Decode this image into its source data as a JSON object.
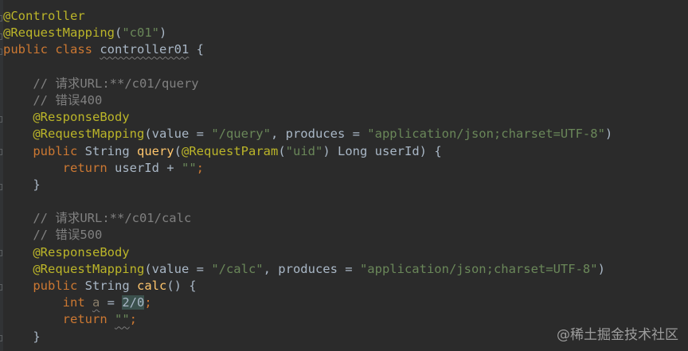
{
  "code_lines": [
    [
      {
        "t": "@Controller",
        "c": "ann"
      }
    ],
    [
      {
        "t": "@RequestMapping",
        "c": "ann"
      },
      {
        "t": "(",
        "c": "plain"
      },
      {
        "t": "\"c01\"",
        "c": "str"
      },
      {
        "t": ")",
        "c": "plain"
      }
    ],
    [
      {
        "t": "public class ",
        "c": "kw"
      },
      {
        "t": "controller01",
        "c": "plain",
        "u": true
      },
      {
        "t": " {",
        "c": "plain"
      }
    ],
    [],
    [
      {
        "t": "    // 请求URL:**/c01/query",
        "c": "cmt"
      }
    ],
    [
      {
        "t": "    // 错误400",
        "c": "cmt"
      }
    ],
    [
      {
        "t": "    ",
        "c": "plain"
      },
      {
        "t": "@ResponseBody",
        "c": "ann"
      }
    ],
    [
      {
        "t": "    ",
        "c": "plain"
      },
      {
        "t": "@RequestMapping",
        "c": "ann"
      },
      {
        "t": "(value = ",
        "c": "plain"
      },
      {
        "t": "\"/query\"",
        "c": "str"
      },
      {
        "t": ", produces = ",
        "c": "plain"
      },
      {
        "t": "\"application/json;charset=UTF-8\"",
        "c": "str"
      },
      {
        "t": ")",
        "c": "plain"
      }
    ],
    [
      {
        "t": "    ",
        "c": "plain"
      },
      {
        "t": "public ",
        "c": "kw"
      },
      {
        "t": "String ",
        "c": "plain"
      },
      {
        "t": "query",
        "c": "fn"
      },
      {
        "t": "(",
        "c": "plain"
      },
      {
        "t": "@RequestParam",
        "c": "ann"
      },
      {
        "t": "(",
        "c": "plain"
      },
      {
        "t": "\"uid\"",
        "c": "str"
      },
      {
        "t": ") Long userId) {",
        "c": "plain"
      }
    ],
    [
      {
        "t": "        ",
        "c": "plain"
      },
      {
        "t": "return ",
        "c": "kw"
      },
      {
        "t": "userId + ",
        "c": "plain"
      },
      {
        "t": "\"\"",
        "c": "str"
      },
      {
        "t": ";",
        "c": "kw"
      }
    ],
    [
      {
        "t": "    }",
        "c": "plain"
      }
    ],
    [],
    [
      {
        "t": "    // 请求URL:**/c01/calc",
        "c": "cmt"
      }
    ],
    [
      {
        "t": "    // 错误500",
        "c": "cmt"
      }
    ],
    [
      {
        "t": "    ",
        "c": "plain"
      },
      {
        "t": "@ResponseBody",
        "c": "ann"
      }
    ],
    [
      {
        "t": "    ",
        "c": "plain"
      },
      {
        "t": "@RequestMapping",
        "c": "ann"
      },
      {
        "t": "(value = ",
        "c": "plain"
      },
      {
        "t": "\"/calc\"",
        "c": "str"
      },
      {
        "t": ", produces = ",
        "c": "plain"
      },
      {
        "t": "\"application/json;charset=UTF-8\"",
        "c": "str"
      },
      {
        "t": ")",
        "c": "plain"
      }
    ],
    [
      {
        "t": "    ",
        "c": "plain"
      },
      {
        "t": "public ",
        "c": "kw"
      },
      {
        "t": "String ",
        "c": "plain"
      },
      {
        "t": "calc",
        "c": "fn"
      },
      {
        "t": "() {",
        "c": "plain"
      }
    ],
    [
      {
        "t": "        ",
        "c": "plain"
      },
      {
        "t": "int ",
        "c": "kw"
      },
      {
        "t": "a",
        "c": "dim",
        "u": true
      },
      {
        "t": " = ",
        "c": "plain"
      },
      {
        "t": "2/0",
        "c": "plain",
        "hl": true
      },
      {
        "t": ";",
        "c": "kw"
      }
    ],
    [
      {
        "t": "        ",
        "c": "plain"
      },
      {
        "t": "return ",
        "c": "kw"
      },
      {
        "t": "\"\"",
        "c": "str",
        "u": true
      },
      {
        "t": ";",
        "c": "kw"
      }
    ],
    [
      {
        "t": "    }",
        "c": "plain"
      }
    ]
  ],
  "watermark": "@稀土掘金技术社区",
  "colors": {
    "background": "#2b2b2b",
    "gutter": "#313335",
    "annotation": "#bbb529",
    "keyword": "#cc7832",
    "string": "#6a8759",
    "comment": "#808080",
    "method": "#ffc66d",
    "default": "#a9b7c6"
  }
}
